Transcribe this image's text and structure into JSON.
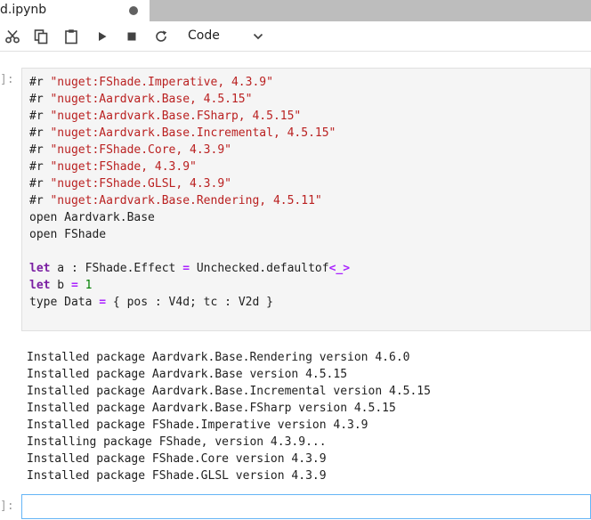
{
  "tab": {
    "title": "d.ipynb",
    "dirty_indicator_color": "#616161"
  },
  "toolbar": {
    "icons": [
      "cut-icon",
      "copy-icon",
      "paste-icon",
      "run-icon",
      "stop-icon",
      "restart-icon"
    ],
    "cell_type": "Code"
  },
  "cells": {
    "input_prompt": "]:",
    "input_lines": [
      {
        "parts": [
          {
            "t": "#r ",
            "c": ""
          },
          {
            "t": "\"nuget:FShade.Imperative, 4.3.9\"",
            "c": "str"
          }
        ]
      },
      {
        "parts": [
          {
            "t": "#r ",
            "c": ""
          },
          {
            "t": "\"nuget:Aardvark.Base, 4.5.15\"",
            "c": "str"
          }
        ]
      },
      {
        "parts": [
          {
            "t": "#r ",
            "c": ""
          },
          {
            "t": "\"nuget:Aardvark.Base.FSharp, 4.5.15\"",
            "c": "str"
          }
        ]
      },
      {
        "parts": [
          {
            "t": "#r ",
            "c": ""
          },
          {
            "t": "\"nuget:Aardvark.Base.Incremental, 4.5.15\"",
            "c": "str"
          }
        ]
      },
      {
        "parts": [
          {
            "t": "#r ",
            "c": ""
          },
          {
            "t": "\"nuget:FShade.Core, 4.3.9\"",
            "c": "str"
          }
        ]
      },
      {
        "parts": [
          {
            "t": "#r ",
            "c": ""
          },
          {
            "t": "\"nuget:FShade, 4.3.9\"",
            "c": "str"
          }
        ]
      },
      {
        "parts": [
          {
            "t": "#r ",
            "c": ""
          },
          {
            "t": "\"nuget:FShade.GLSL, 4.3.9\"",
            "c": "str"
          }
        ]
      },
      {
        "parts": [
          {
            "t": "#r ",
            "c": ""
          },
          {
            "t": "\"nuget:Aardvark.Base.Rendering, 4.5.11\"",
            "c": "str"
          }
        ]
      },
      {
        "parts": [
          {
            "t": "open Aardvark.Base",
            "c": ""
          }
        ]
      },
      {
        "parts": [
          {
            "t": "open FShade",
            "c": ""
          }
        ]
      },
      {
        "parts": [
          {
            "t": "",
            "c": ""
          }
        ]
      },
      {
        "parts": [
          {
            "t": "let",
            "c": "kw"
          },
          {
            "t": " a : FShade.Effect ",
            "c": ""
          },
          {
            "t": "=",
            "c": "op"
          },
          {
            "t": " Unchecked.defaultof",
            "c": ""
          },
          {
            "t": "<_>",
            "c": "op"
          }
        ]
      },
      {
        "parts": [
          {
            "t": "let",
            "c": "kw"
          },
          {
            "t": " b ",
            "c": ""
          },
          {
            "t": "=",
            "c": "op"
          },
          {
            "t": " ",
            "c": ""
          },
          {
            "t": "1",
            "c": "num"
          }
        ]
      },
      {
        "parts": [
          {
            "t": "type Data ",
            "c": ""
          },
          {
            "t": "=",
            "c": "op"
          },
          {
            "t": " { pos : V4d; tc : V2d }",
            "c": ""
          }
        ]
      }
    ],
    "output_lines": [
      "Installed package Aardvark.Base.Rendering version 4.6.0",
      "Installed package Aardvark.Base version 4.5.15",
      "Installed package Aardvark.Base.Incremental version 4.5.15",
      "Installed package Aardvark.Base.FSharp version 4.5.15",
      "Installed package FShade.Imperative version 4.3.9",
      "Installing package FShade, version 4.3.9...",
      "Installed package FShade.Core version 4.3.9",
      "Installed package FShade.GLSL version 4.3.9"
    ],
    "new_cell_prompt": "]:"
  }
}
